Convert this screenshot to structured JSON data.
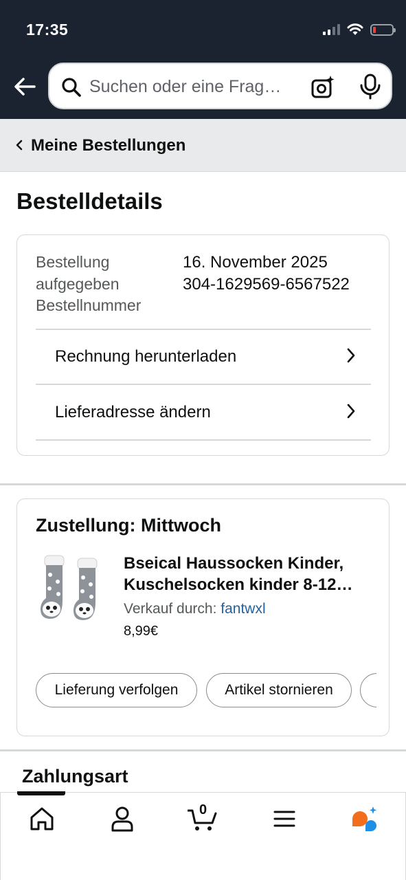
{
  "status_bar": {
    "time": "17:35"
  },
  "search": {
    "placeholder": "Suchen oder eine Frag…"
  },
  "breadcrumb": {
    "label": "Meine Bestellungen"
  },
  "page": {
    "title": "Bestelldetails"
  },
  "order_info": {
    "label_date_1": "Bestellung",
    "label_date_2": "aufgegeben",
    "label_number": "Bestellnummer",
    "date": "16. November 2025",
    "number": "304-1629569-6567522",
    "links": [
      {
        "label": "Rechnung herunterladen"
      },
      {
        "label": "Lieferadresse ändern"
      }
    ]
  },
  "delivery": {
    "title": "Zustellung: Mittwoch",
    "product": {
      "title_line1": "Bseical Haussocken Kinder,",
      "title_line2": "Kuschelsocken kinder 8-12…",
      "seller_prefix": "Verkauf durch:",
      "seller_name": "fantwxl",
      "price": "8,99€"
    },
    "actions": [
      {
        "label": "Lieferung verfolgen"
      },
      {
        "label": "Artikel stornieren"
      }
    ]
  },
  "payment": {
    "title": "Zahlungsart"
  },
  "bottom_nav": {
    "cart_count": "0",
    "items": [
      "home-icon",
      "account-icon",
      "cart-icon",
      "menu-icon",
      "rufus-icon"
    ]
  },
  "colors": {
    "header_bg": "#1b2230",
    "breadcrumb_bg": "#e8eaeb",
    "link": "#2162a1",
    "rufus_orange": "#f26e1d",
    "rufus_blue": "#1f8fe5"
  }
}
